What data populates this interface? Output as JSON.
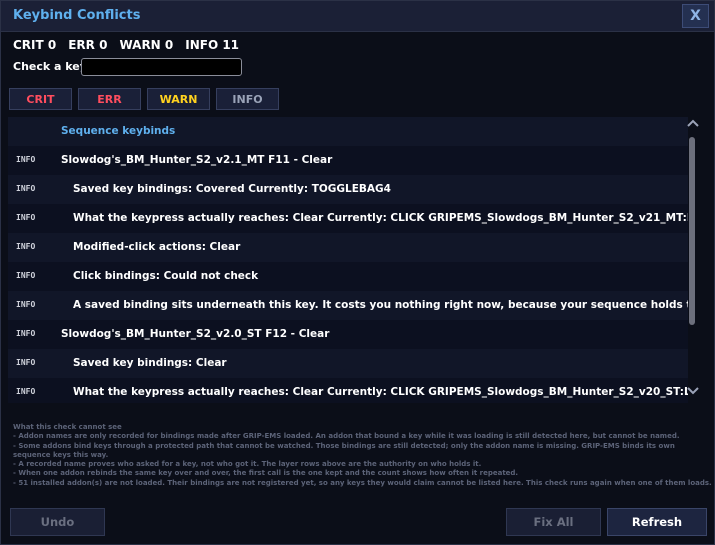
{
  "window": {
    "title": "Keybind Conflicts",
    "close_label": "X"
  },
  "counts": [
    "CRIT 0",
    "ERR 0",
    "WARN 0",
    "INFO 11"
  ],
  "check": {
    "label": "Check a key:",
    "value": "",
    "placeholder": ""
  },
  "filters": {
    "crit": "CRIT",
    "err": "ERR",
    "warn": "WARN",
    "info": "INFO"
  },
  "colors": {
    "crit": "#ff4d5e",
    "err": "#ff4d5e",
    "warn": "#ffd21f",
    "info": "#9aa3b8",
    "accent": "#5fb0ee"
  },
  "list": {
    "section_header": "Sequence keybinds",
    "rows": [
      {
        "tag": "INFO",
        "text": "Slowdog's_BM_Hunter_S2_v2.1_MT  F11  -  Clear"
      },
      {
        "tag": "INFO",
        "text": "Saved key bindings: Covered  Currently: TOGGLEBAG4"
      },
      {
        "tag": "INFO",
        "text": "What the keypress actually reaches: Clear  Currently: CLICK GRIPEMS_Slowdogs_BM_Hunter_S2_v21_MT:Lef..."
      },
      {
        "tag": "INFO",
        "text": "Modified-click actions: Clear"
      },
      {
        "tag": "INFO",
        "text": "Click bindings: Could not check"
      },
      {
        "tag": "INFO",
        "text": "A saved binding sits underneath this key. It costs you nothing right now, because your sequence holds the..."
      },
      {
        "tag": "INFO",
        "text": "Slowdog's_BM_Hunter_S2_v2.0_ST  F12  -  Clear"
      },
      {
        "tag": "INFO",
        "text": "Saved key bindings: Clear"
      },
      {
        "tag": "INFO",
        "text": "What the keypress actually reaches: Clear  Currently: CLICK GRIPEMS_Slowdogs_BM_Hunter_S2_v20_ST:Le..."
      }
    ]
  },
  "scroll": {
    "up_icon": "chevron-up-icon",
    "down_icon": "chevron-down-icon"
  },
  "notes": {
    "heading": "What this check cannot see",
    "lines": [
      "- Addon names are only recorded for bindings made after GRIP-EMS loaded. An addon that bound a key while it was loading is still detected here, but cannot be named.",
      "- Some addons bind keys through a protected path that cannot be watched. Those bindings are still detected; only the addon name is missing. GRIP-EMS binds its own sequence keys this way.",
      "- A recorded name proves who asked for a key, not who got it. The layer rows above are the authority on who holds it.",
      "- When one addon rebinds the same key over and over, the first call is the one kept and the count shows how often it repeated.",
      "- 51 installed addon(s) are not loaded. Their bindings are not registered yet, so any keys they would claim cannot be listed here. This check runs again when one of them loads."
    ]
  },
  "footer": {
    "undo": "Undo",
    "fix_all": "Fix All",
    "refresh": "Refresh"
  }
}
